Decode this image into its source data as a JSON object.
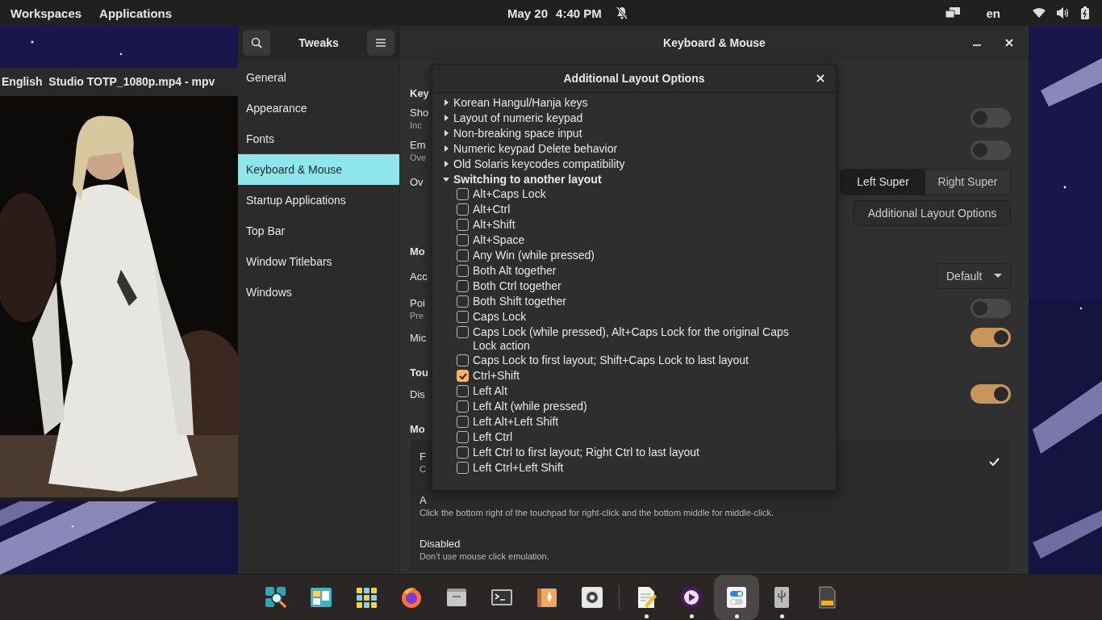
{
  "top_bar": {
    "menus": [
      "Workspaces",
      "Applications"
    ],
    "date": "May 20",
    "time": "4:40 PM",
    "language": "en"
  },
  "player_window": {
    "title": "English  Studio TOTP_1080p.mp4 - mpv",
    "kind": "picture"
  },
  "tweaks": {
    "app_title": "Tweaks",
    "page_title": "Keyboard & Mouse",
    "sidebar": [
      {
        "label": "General",
        "selected": false
      },
      {
        "label": "Appearance",
        "selected": false
      },
      {
        "label": "Fonts",
        "selected": false
      },
      {
        "label": "Keyboard & Mouse",
        "selected": true
      },
      {
        "label": "Startup Applications",
        "selected": false
      },
      {
        "label": "Top Bar",
        "selected": false
      },
      {
        "label": "Window Titlebars",
        "selected": false
      },
      {
        "label": "Windows",
        "selected": false
      }
    ],
    "rows": [
      {
        "kind": "heading",
        "text": "Key"
      },
      {
        "kind": "switch",
        "label": "Sho",
        "note": "Inc",
        "on": false
      },
      {
        "kind": "switch",
        "label": "Em",
        "note": "Ove",
        "on": false
      },
      {
        "kind": "segmented",
        "label": "Ov",
        "options": [
          {
            "label": "Left Super",
            "selected": true
          },
          {
            "label": "Right Super",
            "selected": false
          }
        ]
      },
      {
        "kind": "button",
        "text": "Additional Layout Options"
      },
      {
        "kind": "heading",
        "text": "Mo"
      },
      {
        "kind": "dropdown",
        "label": "Acc",
        "value": "Default"
      },
      {
        "kind": "switch",
        "label": "Poi",
        "note": "Pre",
        "on": false
      },
      {
        "kind": "switch",
        "label": "Mic",
        "on": true
      },
      {
        "kind": "heading",
        "text": "Tou"
      },
      {
        "kind": "switch",
        "label": "Dis",
        "on": true
      },
      {
        "kind": "heading",
        "text": "Mo"
      },
      {
        "kind": "choices",
        "options": [
          {
            "title": "F",
            "desc": "C",
            "selected": true
          },
          {
            "title": "A",
            "desc": "Click the bottom right of the touchpad for right-click and the bottom middle for middle-click.",
            "selected": false
          },
          {
            "title": "Disabled",
            "desc": "Don’t use mouse click emulation.",
            "selected": false
          }
        ]
      }
    ]
  },
  "dialog": {
    "title": "Additional Layout Options",
    "options": [
      {
        "label": "Korean Hangul/Hanja keys",
        "expanded": false
      },
      {
        "label": "Layout of numeric keypad",
        "expanded": false
      },
      {
        "label": "Non-breaking space input",
        "expanded": false
      },
      {
        "label": "Numeric keypad Delete behavior",
        "expanded": false
      },
      {
        "label": "Old Solaris keycodes compatibility",
        "expanded": false
      },
      {
        "label": "Switching to another layout",
        "expanded": true,
        "children": [
          {
            "label": "Alt+Caps Lock",
            "checked": false
          },
          {
            "label": "Alt+Ctrl",
            "checked": false
          },
          {
            "label": "Alt+Shift",
            "checked": false
          },
          {
            "label": "Alt+Space",
            "checked": false
          },
          {
            "label": "Any Win (while pressed)",
            "checked": false
          },
          {
            "label": "Both Alt together",
            "checked": false
          },
          {
            "label": "Both Ctrl together",
            "checked": false
          },
          {
            "label": "Both Shift together",
            "checked": false
          },
          {
            "label": "Caps Lock",
            "checked": false
          },
          {
            "label": "Caps Lock (while pressed), Alt+Caps Lock for the original Caps Lock action",
            "checked": false
          },
          {
            "label": "Caps Lock to first layout; Shift+Caps Lock to last layout",
            "checked": false
          },
          {
            "label": "Ctrl+Shift",
            "checked": true
          },
          {
            "label": "Left Alt",
            "checked": false
          },
          {
            "label": "Left Alt (while pressed)",
            "checked": false
          },
          {
            "label": "Left Alt+Left Shift",
            "checked": false
          },
          {
            "label": "Left Ctrl",
            "checked": false
          },
          {
            "label": "Left Ctrl to first layout; Right Ctrl to last layout",
            "checked": false
          },
          {
            "label": "Left Ctrl+Left Shift",
            "checked": false
          }
        ]
      }
    ]
  },
  "dock": {
    "pinned": [
      {
        "running": false,
        "selected": false
      },
      {
        "running": false,
        "selected": false
      },
      {
        "running": false,
        "selected": false
      },
      {
        "running": false,
        "selected": false
      },
      {
        "running": false,
        "selected": false
      },
      {
        "running": false,
        "selected": false
      },
      {
        "running": false,
        "selected": false
      },
      {
        "running": false,
        "selected": false
      }
    ],
    "open": [
      {
        "running": true,
        "selected": false
      },
      {
        "running": true,
        "selected": false
      },
      {
        "running": true,
        "selected": true
      },
      {
        "running": true,
        "selected": false
      },
      {
        "running": false,
        "selected": false
      }
    ]
  }
}
